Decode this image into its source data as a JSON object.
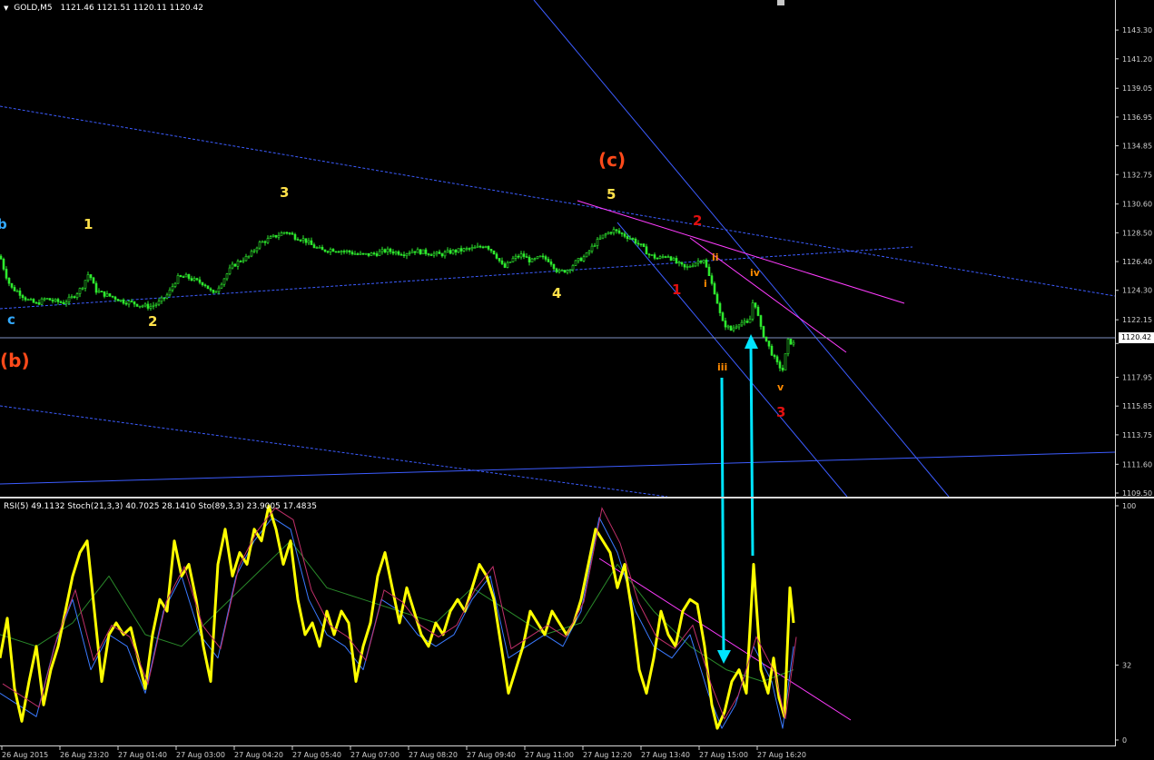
{
  "header": {
    "symbol": "GOLD,M5",
    "ohlc": "1121.46 1121.51 1120.11 1120.42"
  },
  "indicator_header": "RSI(5) 49.1132  Stoch(21,3,3) 40.7025 28.1410  Sto(89,3,3) 23.9005 17.4835",
  "current_price": "1120.42",
  "colors": {
    "candle": "#2eea2e",
    "trend": "#3c5cff",
    "magenta": "#ff3cff",
    "rsi": "#ffff00",
    "cyan": "#00e5ff",
    "wave_yellow": "#ffe14a",
    "wave_red": "#e01010",
    "wave_orange": "#ff4a1a",
    "wave_blue": "#33aaff"
  },
  "chart_data": [
    {
      "type": "candlestick",
      "title": "GOLD,M5",
      "ylim": [
        1109.5,
        1144.5
      ],
      "price_ticks": [
        "1143.30",
        "1141.20",
        "1139.05",
        "1136.95",
        "1134.85",
        "1132.75",
        "1130.60",
        "1128.50",
        "1126.40",
        "1124.30",
        "1122.15",
        "1120.42",
        "1117.95",
        "1115.85",
        "1113.75",
        "1111.60",
        "1109.50"
      ],
      "time_ticks": [
        "26 Aug 2015",
        "26 Aug 23:20",
        "27 Aug 01:40",
        "27 Aug 03:00",
        "27 Aug 04:20",
        "27 Aug 05:40",
        "27 Aug 07:00",
        "27 Aug 08:20",
        "27 Aug 09:40",
        "27 Aug 11:00",
        "27 Aug 12:20",
        "27 Aug 13:40",
        "27 Aug 15:00",
        "27 Aug 16:20"
      ],
      "close_path": [
        [
          0,
          1126.8
        ],
        [
          6,
          1125.5
        ],
        [
          12,
          1124.5
        ],
        [
          20,
          1124.2
        ],
        [
          30,
          1123.6
        ],
        [
          40,
          1123.3
        ],
        [
          50,
          1123.7
        ],
        [
          60,
          1123.5
        ],
        [
          70,
          1123.4
        ],
        [
          80,
          1123.8
        ],
        [
          90,
          1124.5
        ],
        [
          98,
          1125.6
        ],
        [
          105,
          1124.3
        ],
        [
          115,
          1124.0
        ],
        [
          125,
          1123.8
        ],
        [
          135,
          1123.5
        ],
        [
          145,
          1123.4
        ],
        [
          155,
          1123.2
        ],
        [
          165,
          1123.1
        ],
        [
          175,
          1123.4
        ],
        [
          185,
          1124.0
        ],
        [
          195,
          1125.2
        ],
        [
          205,
          1125.3
        ],
        [
          215,
          1125.0
        ],
        [
          225,
          1124.8
        ],
        [
          235,
          1124.0
        ],
        [
          245,
          1125.0
        ],
        [
          255,
          1126.0
        ],
        [
          265,
          1126.5
        ],
        [
          275,
          1126.8
        ],
        [
          285,
          1127.7
        ],
        [
          295,
          1128.0
        ],
        [
          305,
          1128.3
        ],
        [
          315,
          1128.6
        ],
        [
          325,
          1128.2
        ],
        [
          335,
          1128.0
        ],
        [
          345,
          1127.5
        ],
        [
          355,
          1127.2
        ],
        [
          365,
          1127.3
        ],
        [
          375,
          1127.2
        ],
        [
          385,
          1127.1
        ],
        [
          395,
          1126.9
        ],
        [
          405,
          1126.9
        ],
        [
          415,
          1127.0
        ],
        [
          425,
          1127.2
        ],
        [
          435,
          1127.1
        ],
        [
          445,
          1127.0
        ],
        [
          455,
          1127.2
        ],
        [
          465,
          1127.1
        ],
        [
          475,
          1127.0
        ],
        [
          485,
          1126.9
        ],
        [
          495,
          1127.1
        ],
        [
          505,
          1127.2
        ],
        [
          515,
          1127.3
        ],
        [
          525,
          1127.4
        ],
        [
          535,
          1127.6
        ],
        [
          545,
          1127.0
        ],
        [
          555,
          1125.9
        ],
        [
          565,
          1126.6
        ],
        [
          575,
          1126.9
        ],
        [
          585,
          1126.4
        ],
        [
          595,
          1126.7
        ],
        [
          605,
          1126.5
        ],
        [
          615,
          1125.6
        ],
        [
          625,
          1125.8
        ],
        [
          635,
          1126.4
        ],
        [
          645,
          1126.8
        ],
        [
          655,
          1127.7
        ],
        [
          665,
          1128.3
        ],
        [
          675,
          1128.7
        ],
        [
          685,
          1128.4
        ],
        [
          695,
          1128.1
        ],
        [
          705,
          1127.6
        ],
        [
          715,
          1126.9
        ],
        [
          725,
          1126.6
        ],
        [
          735,
          1126.9
        ],
        [
          745,
          1126.3
        ],
        [
          755,
          1125.9
        ],
        [
          765,
          1126.3
        ],
        [
          775,
          1126.6
        ],
        [
          780,
          1125.5
        ],
        [
          788,
          1124.0
        ],
        [
          795,
          1122.0
        ],
        [
          805,
          1121.4
        ],
        [
          815,
          1122.0
        ],
        [
          825,
          1121.8
        ],
        [
          830,
          1123.8
        ],
        [
          838,
          1121.5
        ],
        [
          846,
          1120.3
        ],
        [
          855,
          1119.0
        ],
        [
          862,
          1118.5
        ],
        [
          868,
          1120.6
        ],
        [
          874,
          1120.4
        ]
      ]
    },
    {
      "type": "line",
      "title": "RSI(5) / Stoch(21,3,3) / Sto(89,3,3)",
      "ylim": [
        0,
        100
      ],
      "y_ticks": [
        "100",
        "32",
        "0"
      ],
      "series": [
        {
          "name": "RSI(5)",
          "color": "#ffff00",
          "values": [
            [
              0,
              35
            ],
            [
              8,
              52
            ],
            [
              16,
              22
            ],
            [
              24,
              8
            ],
            [
              32,
              25
            ],
            [
              40,
              40
            ],
            [
              48,
              15
            ],
            [
              56,
              30
            ],
            [
              64,
              40
            ],
            [
              72,
              55
            ],
            [
              80,
              70
            ],
            [
              88,
              80
            ],
            [
              96,
              85
            ],
            [
              104,
              55
            ],
            [
              112,
              25
            ],
            [
              120,
              45
            ],
            [
              128,
              50
            ],
            [
              136,
              45
            ],
            [
              144,
              48
            ],
            [
              152,
              35
            ],
            [
              160,
              22
            ],
            [
              168,
              45
            ],
            [
              176,
              60
            ],
            [
              184,
              55
            ],
            [
              192,
              85
            ],
            [
              200,
              70
            ],
            [
              208,
              75
            ],
            [
              216,
              60
            ],
            [
              224,
              40
            ],
            [
              232,
              25
            ],
            [
              240,
              75
            ],
            [
              248,
              90
            ],
            [
              256,
              70
            ],
            [
              264,
              80
            ],
            [
              272,
              75
            ],
            [
              280,
              90
            ],
            [
              288,
              85
            ],
            [
              296,
              100
            ],
            [
              304,
              90
            ],
            [
              312,
              75
            ],
            [
              320,
              85
            ],
            [
              328,
              60
            ],
            [
              336,
              45
            ],
            [
              344,
              50
            ],
            [
              352,
              40
            ],
            [
              360,
              55
            ],
            [
              368,
              45
            ],
            [
              376,
              55
            ],
            [
              384,
              50
            ],
            [
              392,
              25
            ],
            [
              400,
              40
            ],
            [
              408,
              50
            ],
            [
              416,
              70
            ],
            [
              424,
              80
            ],
            [
              432,
              65
            ],
            [
              440,
              50
            ],
            [
              448,
              65
            ],
            [
              456,
              55
            ],
            [
              464,
              45
            ],
            [
              472,
              40
            ],
            [
              480,
              50
            ],
            [
              488,
              45
            ],
            [
              496,
              55
            ],
            [
              504,
              60
            ],
            [
              512,
              55
            ],
            [
              520,
              65
            ],
            [
              528,
              75
            ],
            [
              536,
              70
            ],
            [
              544,
              60
            ],
            [
              552,
              40
            ],
            [
              560,
              20
            ],
            [
              568,
              30
            ],
            [
              576,
              40
            ],
            [
              584,
              55
            ],
            [
              592,
              50
            ],
            [
              600,
              45
            ],
            [
              608,
              55
            ],
            [
              616,
              50
            ],
            [
              624,
              45
            ],
            [
              632,
              50
            ],
            [
              640,
              60
            ],
            [
              648,
              75
            ],
            [
              656,
              90
            ],
            [
              664,
              85
            ],
            [
              672,
              80
            ],
            [
              680,
              65
            ],
            [
              688,
              75
            ],
            [
              696,
              55
            ],
            [
              704,
              30
            ],
            [
              712,
              20
            ],
            [
              720,
              35
            ],
            [
              728,
              55
            ],
            [
              736,
              45
            ],
            [
              744,
              40
            ],
            [
              752,
              55
            ],
            [
              760,
              60
            ],
            [
              768,
              58
            ],
            [
              776,
              40
            ],
            [
              784,
              15
            ],
            [
              790,
              5
            ],
            [
              798,
              12
            ],
            [
              806,
              25
            ],
            [
              814,
              30
            ],
            [
              822,
              20
            ],
            [
              830,
              75
            ],
            [
              838,
              30
            ],
            [
              846,
              20
            ],
            [
              852,
              35
            ],
            [
              858,
              18
            ],
            [
              864,
              10
            ],
            [
              870,
              65
            ],
            [
              874,
              50
            ]
          ]
        },
        {
          "name": "Stoch(21,3,3)",
          "color": "#3a7aff",
          "values": [
            [
              0,
              20
            ],
            [
              20,
              15
            ],
            [
              40,
              10
            ],
            [
              60,
              40
            ],
            [
              80,
              60
            ],
            [
              100,
              30
            ],
            [
              120,
              45
            ],
            [
              140,
              40
            ],
            [
              160,
              20
            ],
            [
              180,
              55
            ],
            [
              200,
              70
            ],
            [
              220,
              45
            ],
            [
              240,
              35
            ],
            [
              260,
              70
            ],
            [
              280,
              85
            ],
            [
              300,
              95
            ],
            [
              320,
              90
            ],
            [
              340,
              60
            ],
            [
              360,
              45
            ],
            [
              380,
              40
            ],
            [
              400,
              30
            ],
            [
              420,
              60
            ],
            [
              440,
              55
            ],
            [
              460,
              45
            ],
            [
              480,
              40
            ],
            [
              500,
              45
            ],
            [
              520,
              60
            ],
            [
              540,
              70
            ],
            [
              560,
              35
            ],
            [
              580,
              40
            ],
            [
              600,
              45
            ],
            [
              620,
              40
            ],
            [
              640,
              55
            ],
            [
              660,
              95
            ],
            [
              680,
              80
            ],
            [
              700,
              55
            ],
            [
              720,
              40
            ],
            [
              740,
              35
            ],
            [
              760,
              45
            ],
            [
              780,
              20
            ],
            [
              795,
              5
            ],
            [
              810,
              15
            ],
            [
              830,
              40
            ],
            [
              850,
              25
            ],
            [
              862,
              5
            ],
            [
              874,
              40
            ]
          ]
        },
        {
          "name": "Sto(89,3,3)",
          "color": "#2a8a2a",
          "values": [
            [
              0,
              45
            ],
            [
              40,
              40
            ],
            [
              80,
              50
            ],
            [
              120,
              70
            ],
            [
              160,
              45
            ],
            [
              200,
              40
            ],
            [
              240,
              55
            ],
            [
              280,
              70
            ],
            [
              320,
              85
            ],
            [
              360,
              65
            ],
            [
              400,
              60
            ],
            [
              440,
              55
            ],
            [
              480,
              50
            ],
            [
              520,
              65
            ],
            [
              560,
              55
            ],
            [
              600,
              45
            ],
            [
              640,
              50
            ],
            [
              680,
              75
            ],
            [
              720,
              55
            ],
            [
              760,
              40
            ],
            [
              800,
              30
            ],
            [
              840,
              25
            ],
            [
              874,
              30
            ]
          ]
        }
      ]
    }
  ],
  "wave_labels": {
    "w1": "1",
    "w2": "2",
    "w3": "3",
    "w4": "4",
    "w5": "5",
    "c_big": "(c)",
    "b_big": "(b)",
    "c_small": "c",
    "b_small": "b",
    "r1": "1",
    "r2": "2",
    "r3": "3",
    "i": "i",
    "ii": "ii",
    "iii": "iii",
    "iv": "iv",
    "v": "v"
  }
}
